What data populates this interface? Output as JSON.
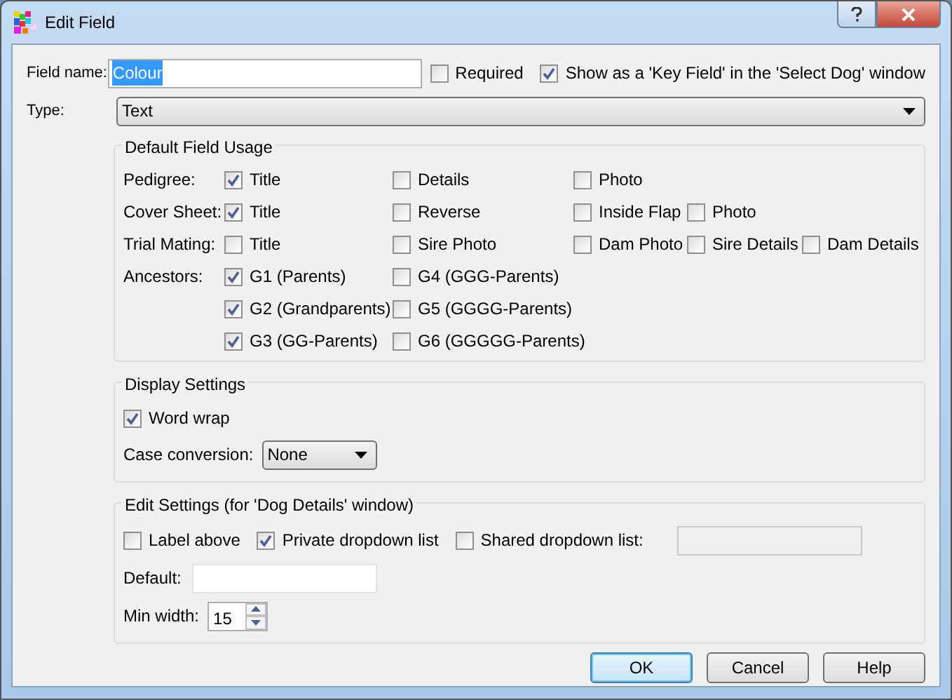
{
  "window": {
    "title": "Edit Field"
  },
  "field_name": {
    "label": "Field name:",
    "value": "Colour",
    "text_selected": true
  },
  "header_checks": [
    {
      "label": "Required",
      "checked": false
    },
    {
      "label": "Show as a 'Key Field' in the 'Select Dog' window",
      "checked": true
    }
  ],
  "type": {
    "label": "Type:",
    "value": "Text"
  },
  "default_field_usage": {
    "title": "Default Field Usage",
    "rows": [
      {
        "label": "Pedigree:",
        "options": [
          {
            "label": "Title",
            "checked": true
          },
          {
            "label": "Details",
            "checked": false
          },
          {
            "label": "Photo",
            "checked": false
          }
        ]
      },
      {
        "label": "Cover Sheet:",
        "options": [
          {
            "label": "Title",
            "checked": true
          },
          {
            "label": "Reverse",
            "checked": false
          },
          {
            "label": "Inside Flap",
            "checked": false
          },
          {
            "label": "Photo",
            "checked": false
          }
        ]
      },
      {
        "label": "Trial Mating:",
        "options": [
          {
            "label": "Title",
            "checked": false
          },
          {
            "label": "Sire Photo",
            "checked": false
          },
          {
            "label": "Dam Photo",
            "checked": false
          },
          {
            "label": "Sire Details",
            "checked": false
          },
          {
            "label": "Dam Details",
            "checked": false
          }
        ]
      },
      {
        "label": "Ancestors:",
        "options": [
          {
            "label": "G1 (Parents)",
            "checked": true
          },
          {
            "label": "G4 (GGG-Parents)",
            "checked": false
          }
        ]
      },
      {
        "options": [
          {
            "label": "G2 (Grandparents)",
            "checked": true
          },
          {
            "label": "G5 (GGGG-Parents)",
            "checked": false
          }
        ]
      },
      {
        "options": [
          {
            "label": "G3 (GG-Parents)",
            "checked": true
          },
          {
            "label": "G6 (GGGGG-Parents)",
            "checked": false
          }
        ]
      }
    ]
  },
  "display_settings": {
    "title": "Display Settings",
    "word_wrap": {
      "label": "Word wrap",
      "checked": true
    },
    "case_conversion": {
      "label": "Case conversion:",
      "value": "None"
    }
  },
  "edit_settings": {
    "title": "Edit Settings (for 'Dog Details' window)",
    "checks": [
      {
        "label": "Label above",
        "checked": false
      },
      {
        "label": "Private dropdown list",
        "checked": true
      },
      {
        "label": "Shared dropdown list:",
        "checked": false
      }
    ],
    "default": {
      "label": "Default:"
    },
    "min_width": {
      "label": "Min width:",
      "value": "15"
    }
  },
  "buttons": [
    {
      "label": "OK",
      "default": true
    },
    {
      "label": "Cancel",
      "default": false
    },
    {
      "label": "Help",
      "default": false
    }
  ]
}
